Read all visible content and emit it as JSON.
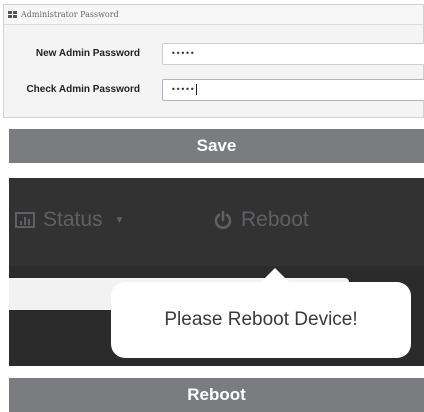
{
  "admin_password": {
    "header_title": "Administrator Password",
    "header_icon": "grid-icon",
    "new_password_label": "New Admin Password",
    "new_password_value": "•••••",
    "check_password_label": "Check Admin Password",
    "check_password_value": "•••••"
  },
  "save_button": {
    "label": "Save"
  },
  "navbar": {
    "status_label": "Status",
    "status_icon": "bar-chart-icon",
    "reboot_label": "Reboot",
    "reboot_icon": "power-icon"
  },
  "popover": {
    "message": "Please Reboot Device!"
  },
  "reboot_button": {
    "label": "Reboot"
  },
  "colors": {
    "action_bar": "#7a7c80",
    "nav_background": "#2b2b2c",
    "nav_text": "#5f6064"
  }
}
